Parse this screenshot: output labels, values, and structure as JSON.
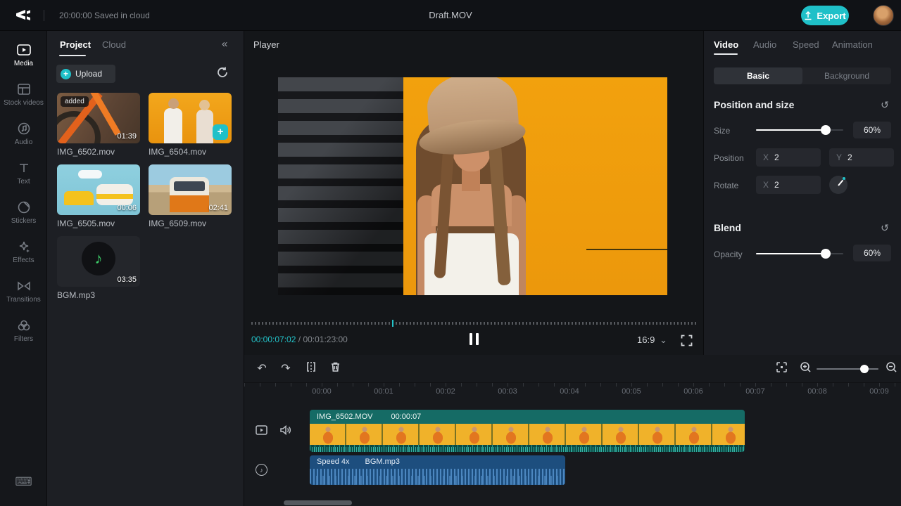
{
  "topbar": {
    "autosave": "20:00:00 Saved in cloud",
    "title": "Draft.MOV",
    "export_label": "Export"
  },
  "nav": {
    "items": [
      {
        "label": "Media",
        "active": true
      },
      {
        "label": "Stock videos",
        "active": false
      },
      {
        "label": "Audio",
        "active": false
      },
      {
        "label": "Text",
        "active": false
      },
      {
        "label": "Stickers",
        "active": false
      },
      {
        "label": "Effects",
        "active": false
      },
      {
        "label": "Transitions",
        "active": false
      },
      {
        "label": "Filters",
        "active": false
      }
    ]
  },
  "project": {
    "tabs": [
      {
        "label": "Project",
        "active": true
      },
      {
        "label": "Cloud",
        "active": false
      }
    ],
    "upload_label": "Upload",
    "items": [
      {
        "name": "IMG_6502.mov",
        "duration": "01:39",
        "badge": "added"
      },
      {
        "name": "IMG_6504.mov"
      },
      {
        "name": "IMG_6505.mov",
        "duration": "00:06"
      },
      {
        "name": "IMG_6509.mov",
        "duration": "02:41"
      },
      {
        "name": "BGM.mp3",
        "duration": "03:35",
        "type": "audio"
      }
    ]
  },
  "player": {
    "title": "Player",
    "current_time": "00:00:07:02",
    "separator": "/",
    "total_time": "00:01:23:00",
    "aspect_ratio": "16:9"
  },
  "inspector": {
    "tabs": [
      {
        "label": "Video",
        "active": true
      },
      {
        "label": "Audio",
        "active": false
      },
      {
        "label": "Speed",
        "active": false
      },
      {
        "label": "Animation",
        "active": false
      }
    ],
    "segments": [
      {
        "label": "Basic",
        "active": true
      },
      {
        "label": "Background",
        "active": false
      }
    ],
    "position_size": {
      "title": "Position and size",
      "size_label": "Size",
      "size_value": "60%",
      "position_label": "Position",
      "x_label": "X",
      "x_value": "2",
      "y_label": "Y",
      "y_value": "2",
      "rotate_label": "Rotate",
      "rotate_x_label": "X",
      "rotate_value": "2"
    },
    "blend": {
      "title": "Blend",
      "opacity_label": "Opacity",
      "opacity_value": "60%"
    }
  },
  "timeline": {
    "ruler": [
      "00:00",
      "00:01",
      "00:02",
      "00:03",
      "00:04",
      "00:05",
      "00:06",
      "00:07",
      "00:08",
      "00:09"
    ],
    "video_clip": {
      "name": "IMG_6502.MOV",
      "duration": "00:00:07"
    },
    "audio_clip": {
      "speed": "Speed 4x",
      "name": "BGM.mp3"
    }
  },
  "icons": {
    "collapse": "«",
    "reset": "↺",
    "chevron_down": "⌄",
    "music_note": "♪",
    "keyboard": "⌨",
    "undo": "↶",
    "redo": "↷",
    "plus": "+"
  },
  "colors": {
    "accent": "#23c3c9",
    "export": "#1fc0c8",
    "video_clip": "#156b65",
    "audio_clip": "#1d4e7e"
  }
}
